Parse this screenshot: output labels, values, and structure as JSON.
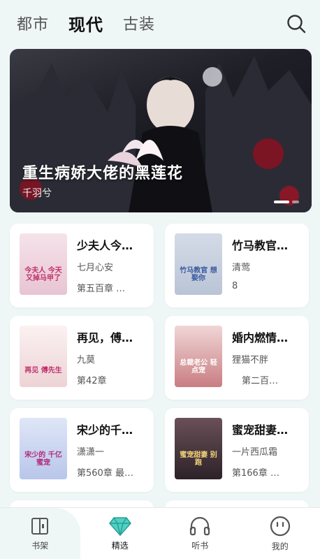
{
  "tabs": [
    "都市",
    "现代",
    "古装"
  ],
  "banner": {
    "title": "重生病娇大佬的黑莲花",
    "author": "千羽兮"
  },
  "books": [
    {
      "title": "少夫人今…",
      "author": "七月心安",
      "chapter": "第五百章 …",
      "cover_text": "今夫人 今天又掉马甲了",
      "cover_color": "#f3dfe6"
    },
    {
      "title": "竹马教官…",
      "author": "清莺",
      "chapter": "8",
      "cover_text": "竹马教官 想娶你",
      "cover_color": "#dfe6ee"
    },
    {
      "title": "再见，傅…",
      "author": "九莫",
      "chapter": "第42章",
      "cover_text": "再见 傅先生",
      "cover_color": "#f7eaea"
    },
    {
      "title": "婚内燃情…",
      "author": "狸猫不胖",
      "chapter": "第二百…",
      "cover_text": "总裁老公 轻点宠",
      "cover_color": "#f0d9d9"
    },
    {
      "title": "宋少的千…",
      "author": "潇潇一",
      "chapter": "第560章 最…",
      "cover_text": "宋少的 千亿蜜宠",
      "cover_color": "#dde4f5"
    },
    {
      "title": "蜜宠甜妻…",
      "author": "一片西瓜霜",
      "chapter": "第166章 …",
      "cover_text": "蜜宠甜妻 别跑",
      "cover_color": "#4a3a40"
    }
  ],
  "nav": [
    {
      "label": "书架",
      "icon": "bookshelf-icon"
    },
    {
      "label": "精选",
      "icon": "diamond-icon"
    },
    {
      "label": "听书",
      "icon": "headphones-icon"
    },
    {
      "label": "我的",
      "icon": "face-icon"
    }
  ]
}
